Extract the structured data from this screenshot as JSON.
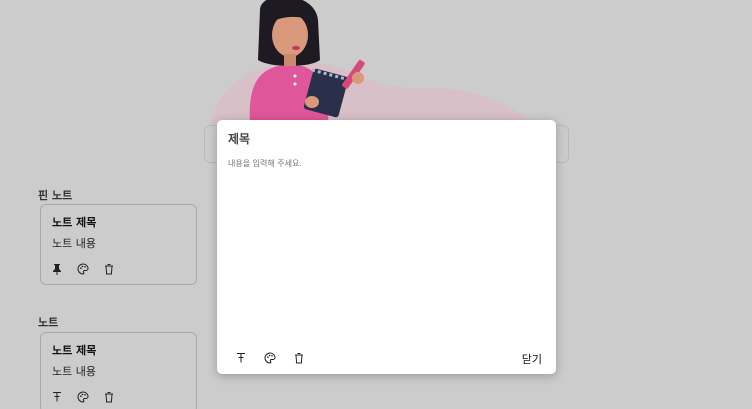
{
  "hero": {
    "illustration": "woman-writing-in-notebook"
  },
  "pinned_section": {
    "title": "핀 노트",
    "notes": [
      {
        "title": "노트 제목",
        "body": "노트 내용"
      }
    ]
  },
  "others_section": {
    "title": "노트",
    "notes": [
      {
        "title": "노트 제목",
        "body": "노트 내용"
      }
    ]
  },
  "modal": {
    "title": "제목",
    "body_placeholder": "내용을 입력해 주세요.",
    "close_label": "닫기"
  },
  "icons": [
    "pin-icon",
    "palette-icon",
    "trash-icon"
  ],
  "colors": {
    "overlay": "#cccccc",
    "modal_bg": "#ffffff",
    "hero_accent": "#e0569a"
  }
}
